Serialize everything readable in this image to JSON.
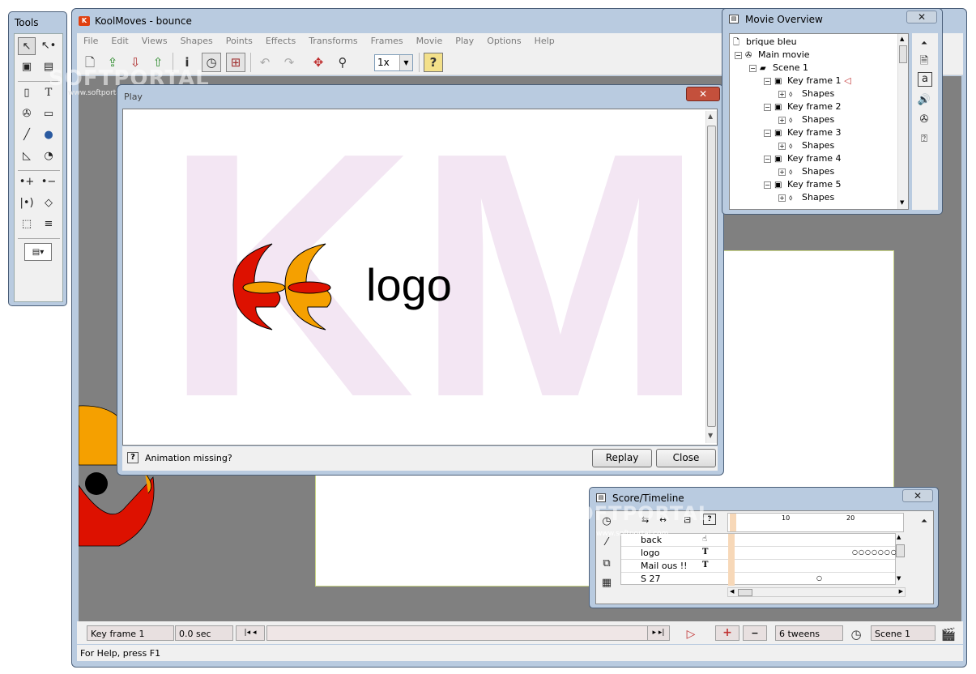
{
  "main_window": {
    "title": "KoolMoves - bounce"
  },
  "menu": [
    "File",
    "Edit",
    "Views",
    "Shapes",
    "Points",
    "Effects",
    "Transforms",
    "Frames",
    "Movie",
    "Play",
    "Options",
    "Help"
  ],
  "toolbar": {
    "icons": [
      "new-file-icon",
      "open-file-icon",
      "save-file-icon",
      "export-icon",
      "info-icon",
      "timeline-icon",
      "movie-overview-icon",
      "undo-icon",
      "redo-icon",
      "pan-icon",
      "zoom-icon",
      "help-icon"
    ],
    "zoom_value": "1x"
  },
  "tools": {
    "title": "Tools"
  },
  "watermark": {
    "brand": "SOFTPORTAL",
    "url": "www.softportal.com"
  },
  "play_dialog": {
    "title": "Play",
    "stage_text": "logo",
    "background_letters": "KM",
    "animation_missing": "Animation missing?",
    "replay_label": "Replay",
    "close_label": "Close"
  },
  "movie_overview": {
    "title": "Movie Overview",
    "tree": [
      {
        "label": "brique bleu",
        "depth": 0,
        "icon": "file-icon"
      },
      {
        "label": "Main movie",
        "depth": 1,
        "icon": "film-reel-icon"
      },
      {
        "label": "Scene 1",
        "depth": 2,
        "icon": "scene-icon"
      },
      {
        "label": "Key frame 1",
        "depth": 3,
        "icon": "frame-icon",
        "current": true
      },
      {
        "label": "Shapes",
        "depth": 4,
        "icon": "shapes-icon"
      },
      {
        "label": "Key frame 2",
        "depth": 3,
        "icon": "frame-icon"
      },
      {
        "label": "Shapes",
        "depth": 4,
        "icon": "shapes-icon"
      },
      {
        "label": "Key frame 3",
        "depth": 3,
        "icon": "frame-icon"
      },
      {
        "label": "Shapes",
        "depth": 4,
        "icon": "shapes-icon"
      },
      {
        "label": "Key frame 4",
        "depth": 3,
        "icon": "frame-icon"
      },
      {
        "label": "Shapes",
        "depth": 4,
        "icon": "shapes-icon"
      },
      {
        "label": "Key frame 5",
        "depth": 3,
        "icon": "frame-icon"
      },
      {
        "label": "Shapes",
        "depth": 4,
        "icon": "shapes-icon"
      }
    ]
  },
  "score": {
    "title": "Score/Timeline",
    "ruler_labels": [
      "10",
      "20"
    ],
    "layers": [
      "back",
      "logo",
      "Mail ous !!",
      "S 27"
    ]
  },
  "status": {
    "frame": "Key frame 1",
    "time": "0.0 sec",
    "tweens": "6 tweens",
    "scene": "Scene 1",
    "help": "For Help, press F1"
  },
  "colors": {
    "frame_border": "#b9cbe0",
    "close_red": "#c4503c",
    "km_pink": "#f3e6f3",
    "logo_red": "#dd1100",
    "logo_orange": "#f5a000"
  }
}
